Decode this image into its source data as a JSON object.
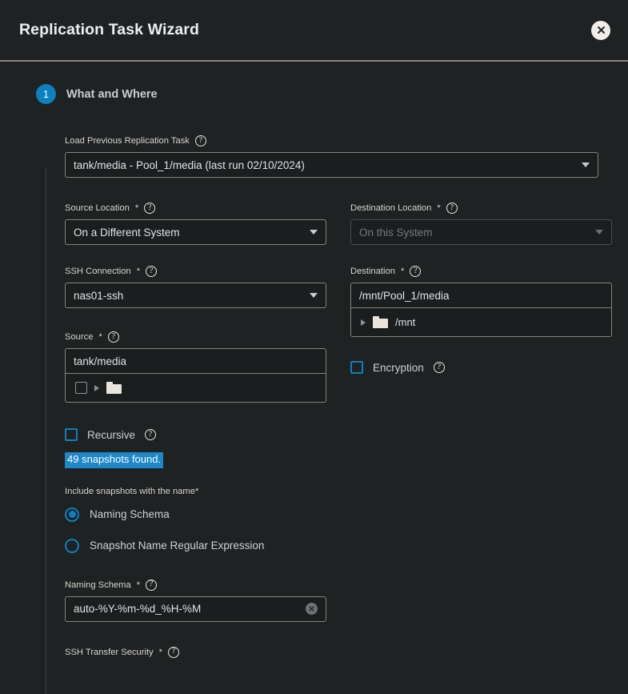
{
  "header": {
    "title": "Replication Task Wizard",
    "close_label": "×"
  },
  "step": {
    "number": "1",
    "label": "What and Where"
  },
  "fields": {
    "load_previous": {
      "label": "Load Previous Replication Task",
      "value": "tank/media - Pool_1/media (last run 02/10/2024)",
      "required": false
    },
    "source_location": {
      "label": "Source Location",
      "required_mark": "*",
      "value": "On a Different System"
    },
    "destination_location": {
      "label": "Destination Location",
      "required_mark": "*",
      "value": "On this System",
      "disabled": true
    },
    "ssh_connection": {
      "label": "SSH Connection",
      "required_mark": "*",
      "value": "nas01-ssh"
    },
    "destination": {
      "label": "Destination",
      "required_mark": "*",
      "value": "/mnt/Pool_1/media",
      "tree_item": "/mnt"
    },
    "source": {
      "label": "Source",
      "required_mark": "*",
      "value": "tank/media",
      "tree_item": ""
    },
    "encryption": {
      "label": "Encryption",
      "checked": false
    },
    "recursive": {
      "label": "Recursive",
      "checked": false
    },
    "snapshots_found": "49 snapshots found.",
    "include_snapshots": {
      "label": "Include snapshots with the name",
      "required_mark": "*",
      "options": [
        {
          "label": "Naming Schema",
          "selected": true
        },
        {
          "label": "Snapshot Name Regular Expression",
          "selected": false
        }
      ]
    },
    "naming_schema": {
      "label": "Naming Schema",
      "required_mark": "*",
      "value": "auto-%Y-%m-%d_%H-%M"
    },
    "ssh_transfer_security": {
      "label": "SSH Transfer Security",
      "required_mark": "*"
    }
  },
  "icons": {
    "help": "?",
    "clear": "×"
  },
  "colors": {
    "accent": "#0d80c0",
    "selection": "#1e87c8",
    "background": "#1e2223",
    "border": "#8a8376"
  }
}
